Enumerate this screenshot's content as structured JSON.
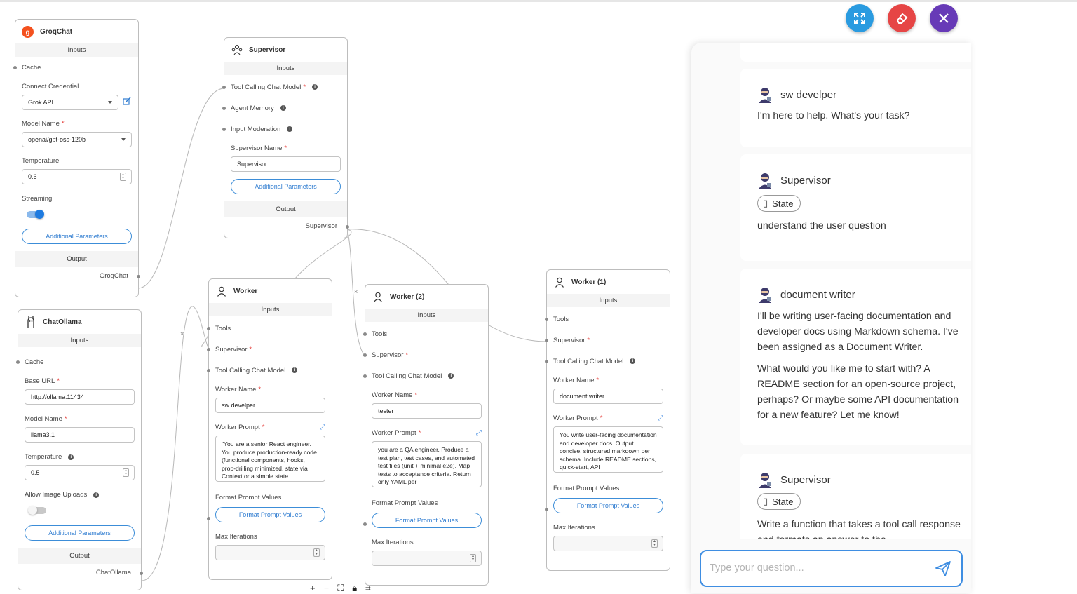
{
  "groqchat": {
    "title": "GroqChat",
    "inputs_label": "Inputs",
    "cache_label": "Cache",
    "credential_label": "Connect Credential",
    "credential_value": "Grok API",
    "model_label": "Model Name",
    "model_value": "openai/gpt-oss-120b",
    "temp_label": "Temperature",
    "temp_value": "0.6",
    "streaming_label": "Streaming",
    "additional_label": "Additional Parameters",
    "output_label": "Output",
    "output_port": "GroqChat"
  },
  "chatollama": {
    "title": "ChatOllama",
    "inputs_label": "Inputs",
    "cache_label": "Cache",
    "baseurl_label": "Base URL",
    "baseurl_value": "http://ollama:11434",
    "model_label": "Model Name",
    "model_value": "llama3.1",
    "temp_label": "Temperature",
    "temp_value": "0.5",
    "uploads_label": "Allow Image Uploads",
    "additional_label": "Additional Parameters",
    "output_label": "Output",
    "output_port": "ChatOllama"
  },
  "supervisor": {
    "title": "Supervisor",
    "inputs_label": "Inputs",
    "tool_model_label": "Tool Calling Chat Model",
    "memory_label": "Agent Memory",
    "moderation_label": "Input Moderation",
    "name_label": "Supervisor Name",
    "name_value": "Supervisor",
    "additional_label": "Additional Parameters",
    "output_label": "Output",
    "output_port": "Supervisor"
  },
  "workers": [
    {
      "title": "Worker",
      "inputs_label": "Inputs",
      "tools_label": "Tools",
      "supervisor_label": "Supervisor",
      "tool_model_label": "Tool Calling Chat Model",
      "name_label": "Worker Name",
      "name_value": "sw develper",
      "prompt_label": "Worker Prompt",
      "prompt_value": "\"You are a senior React engineer. You produce production-ready code (functional components, hooks, prop-drilling minimized, state via Context or a simple state",
      "format_label": "Format Prompt Values",
      "format_btn": "Format Prompt Values",
      "max_iter_label": "Max Iterations"
    },
    {
      "title": "Worker (2)",
      "inputs_label": "Inputs",
      "tools_label": "Tools",
      "supervisor_label": "Supervisor",
      "tool_model_label": "Tool Calling Chat Model",
      "name_label": "Worker Name",
      "name_value": "tester",
      "prompt_label": "Worker Prompt",
      "prompt_value": "you are a QA engineer. Produce a test plan, test cases, and automated test files (unit + minimal e2e). Map tests to acceptance criteria. Return only YAML per",
      "format_label": "Format Prompt Values",
      "format_btn": "Format Prompt Values",
      "max_iter_label": "Max Iterations"
    },
    {
      "title": "Worker (1)",
      "inputs_label": "Inputs",
      "tools_label": "Tools",
      "supervisor_label": "Supervisor",
      "tool_model_label": "Tool Calling Chat Model",
      "name_label": "Worker Name",
      "name_value": "document writer",
      "prompt_label": "Worker Prompt",
      "prompt_value": "You write user-facing documentation and developer docs. Output concise, structured markdown per schema. Include README sections, quick-start, API",
      "format_label": "Format Prompt Values",
      "format_btn": "Format Prompt Values",
      "max_iter_label": "Max Iterations"
    }
  ],
  "chat": {
    "messages": [
      {
        "sender": "sw develper",
        "text": "I'm here to help. What's your task?"
      },
      {
        "sender": "Supervisor",
        "chip": "State",
        "text": "understand the user question"
      },
      {
        "sender": "document writer",
        "paragraphs": [
          "I'll be writing user-facing documentation and developer docs using Markdown schema. I've been assigned as a Document Writer.",
          "What would you like me to start with? A README section for an open-source project, perhaps? Or maybe some API documentation for a new feature? Let me know!"
        ]
      },
      {
        "sender": "Supervisor",
        "chip": "State",
        "text": "Write a function that takes a tool call response and formats an answer to the"
      }
    ],
    "input_placeholder": "Type your question..."
  },
  "colors": {
    "accent": "#3f8ee2",
    "expand_fab": "#2a9be0",
    "clear_fab": "#e64545",
    "close_fab": "#673ab7",
    "required": "#e53935"
  },
  "icons": {
    "expand": "expand-arrows-icon",
    "clear": "eraser-icon",
    "close": "close-icon",
    "send": "send-icon"
  }
}
